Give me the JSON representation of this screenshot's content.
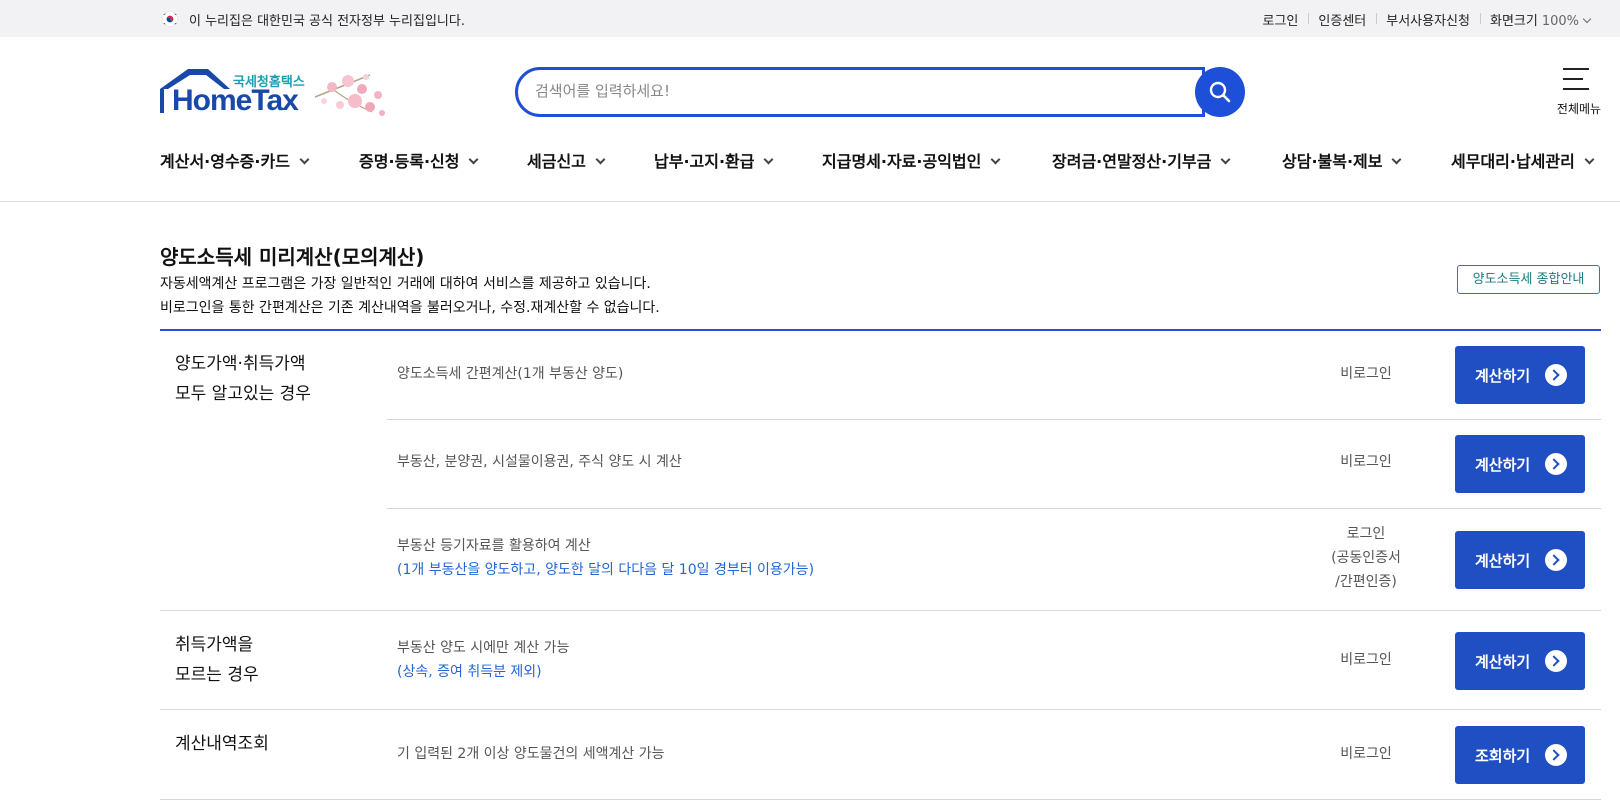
{
  "gov_bar": {
    "notice": "이 누리집은 대한민국 공식 전자정부 누리집입니다.",
    "links": [
      "로그인",
      "인증센터",
      "부서사용자신청",
      "화면크기"
    ],
    "zoom_value": "100%"
  },
  "header": {
    "logo_sub": "국세청홈택스",
    "logo_main": "HomeTax",
    "search_placeholder": "검색어를 입력하세요!",
    "all_menu_label": "전체메뉴"
  },
  "gnb": [
    "계산서·영수증·카드",
    "증명·등록·신청",
    "세금신고",
    "납부·고지·환급",
    "지급명세·자료·공익법인",
    "장려금·연말정산·기부금",
    "상담·불복·제보",
    "세무대리·납세관리"
  ],
  "page": {
    "title": "양도소득세 미리계산(모의계산)",
    "desc1": "자동세액계산 프로그램은 가장 일반적인 거래에 대하여 서비스를 제공하고 있습니다.",
    "desc2": "비로그인을 통한 간편계산은 기존 계산내역을 불러오거나, 수정.재계산할 수 없습니다.",
    "guide_button": "양도소득세 종합안내"
  },
  "groups": [
    {
      "category": [
        "양도가액·취득가액",
        "모두 알고있는 경우"
      ],
      "rows": [
        {
          "desc": "양도소득세 간편계산(1개 부동산 양도)",
          "note": "",
          "login": [
            "비로그인"
          ],
          "button": "계산하기"
        },
        {
          "desc": "부동산, 분양권, 시설물이용권, 주식 양도 시 계산",
          "note": "",
          "login": [
            "비로그인"
          ],
          "button": "계산하기"
        },
        {
          "desc": "부동산 등기자료를 활용하여 계산",
          "note": "(1개 부동산을 양도하고, 양도한 달의 다다음 달 10일 경부터 이용가능)",
          "login": [
            "로그인",
            "(공동인증서",
            "/간편인증)"
          ],
          "button": "계산하기"
        }
      ]
    },
    {
      "category": [
        "취득가액을",
        "모르는 경우"
      ],
      "rows": [
        {
          "desc": "부동산 양도 시에만 계산 가능",
          "note": "(상속, 증여 취득분 제외)",
          "login": [
            "비로그인"
          ],
          "button": "계산하기"
        }
      ]
    },
    {
      "category": [
        "계산내역조회"
      ],
      "rows": [
        {
          "desc": "기 입력된 2개 이상 양도물건의 세액계산 가능",
          "note": "",
          "login": [
            "비로그인"
          ],
          "button": "조회하기"
        }
      ]
    }
  ],
  "colors": {
    "primary": "#1f4fc2",
    "accent_teal": "#1a8a8e",
    "note_blue": "#2367d3"
  }
}
